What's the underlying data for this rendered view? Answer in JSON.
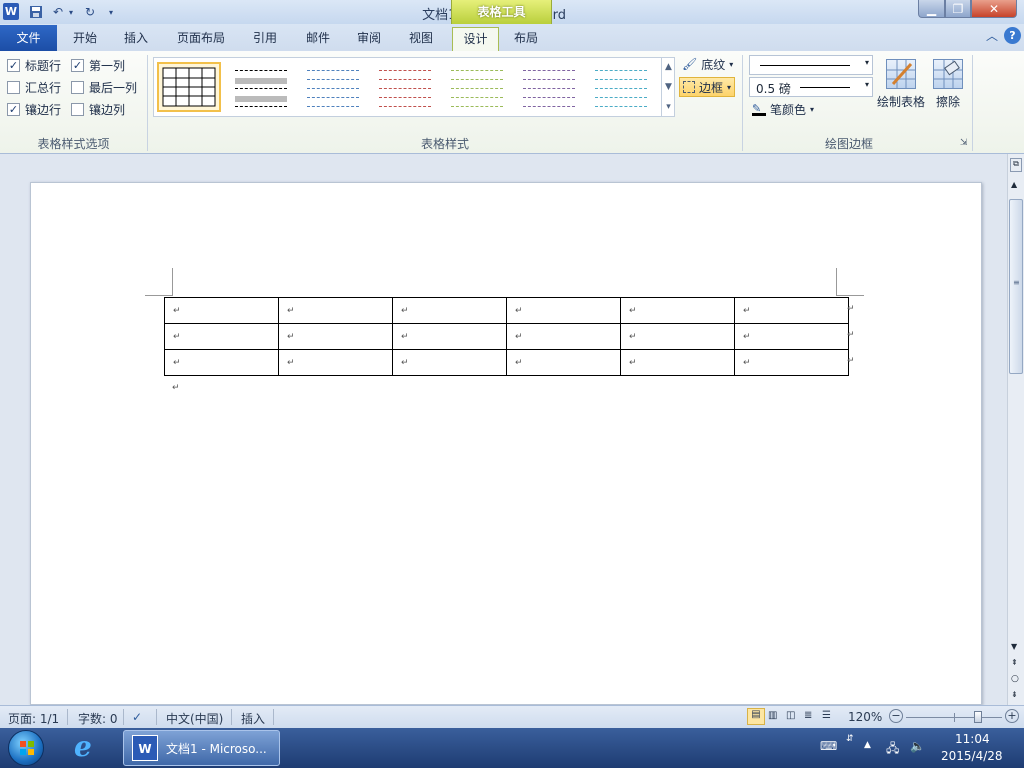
{
  "window": {
    "title": "文档1 - Microsoft Word",
    "context_tab_title": "表格工具"
  },
  "tabs": {
    "file": "文件",
    "items": [
      "开始",
      "插入",
      "页面布局",
      "引用",
      "邮件",
      "审阅",
      "视图",
      "设计",
      "布局"
    ],
    "active": "设计"
  },
  "ribbon": {
    "style_options": {
      "label": "表格样式选项",
      "header_row": {
        "label": "标题行",
        "checked": true
      },
      "first_column": {
        "label": "第一列",
        "checked": true
      },
      "total_row": {
        "label": "汇总行",
        "checked": false
      },
      "last_column": {
        "label": "最后一列",
        "checked": false
      },
      "banded_rows": {
        "label": "镶边行",
        "checked": true
      },
      "banded_columns": {
        "label": "镶边列",
        "checked": false
      }
    },
    "table_styles": {
      "label": "表格样式",
      "shading": "底纹",
      "borders": "边框",
      "style_colors": [
        "#000000",
        "#333333",
        "#4f81bd",
        "#c0504d",
        "#9bbb59",
        "#8064a2",
        "#4bacc6"
      ]
    },
    "draw_borders": {
      "label": "绘图边框",
      "pen_weight": "0.5 磅",
      "pen_color": "笔颜色",
      "draw_table": "绘制表格",
      "eraser": "擦除"
    }
  },
  "document": {
    "rows": 3,
    "cols": 6,
    "cell_mark": "↵"
  },
  "status": {
    "page": "页面: 1/1",
    "words": "字数: 0",
    "language": "中文(中国)",
    "mode": "插入",
    "zoom": "120%",
    "zoom_level": 0.75
  },
  "taskbar": {
    "task_label": "文档1 - Microso...",
    "time": "11:04",
    "date": "2015/4/28"
  }
}
